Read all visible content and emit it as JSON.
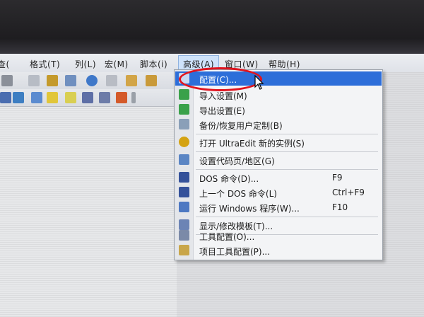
{
  "menubar": {
    "items": [
      "查(",
      "格式(T)",
      "列(L)",
      "宏(M)",
      "脚本(i)",
      "高级(A)",
      "窗口(W)",
      "帮助(H)"
    ]
  },
  "dropdown": {
    "items": [
      {
        "label": "配置(C)...",
        "shortcut": "",
        "icon": "config-icon"
      },
      {
        "label": "导入设置(M)",
        "shortcut": "",
        "icon": "import-arrow-icon"
      },
      {
        "label": "导出设置(E)",
        "shortcut": "",
        "icon": "export-arrow-icon"
      },
      {
        "label": "备份/恢复用户定制(B)",
        "shortcut": "",
        "icon": "backup-icon"
      },
      {
        "label": "打开 UltraEdit 新的实例(S)",
        "shortcut": "",
        "icon": "ultraedit-icon"
      },
      {
        "label": "设置代码页/地区(G)",
        "shortcut": "",
        "icon": "codepage-icon"
      },
      {
        "label": "DOS 命令(D)...",
        "shortcut": "F9",
        "icon": "dos-icon"
      },
      {
        "label": "上一个 DOS 命令(L)",
        "shortcut": "Ctrl+F9",
        "icon": "dos-last-icon"
      },
      {
        "label": "运行 Windows 程序(W)...",
        "shortcut": "F10",
        "icon": "run-windows-icon"
      },
      {
        "label": "显示/修改模板(T)...",
        "shortcut": "",
        "icon": "template-icon"
      },
      {
        "label": "工具配置(O)...",
        "shortcut": "",
        "icon": "tool-config-icon"
      },
      {
        "label": "项目工具配置(P)...",
        "shortcut": "",
        "icon": "project-tool-config-icon"
      }
    ]
  },
  "colors": {
    "highlight": "#2d6ed9",
    "annotation": "#e0141e"
  }
}
